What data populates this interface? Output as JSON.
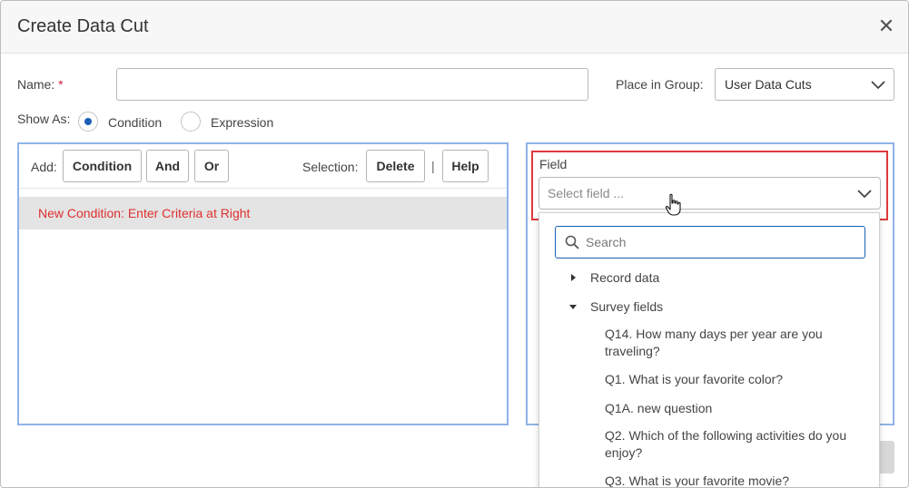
{
  "dialog": {
    "title": "Create Data Cut",
    "close_glyph": "✕"
  },
  "form": {
    "name_label": "Name:",
    "required_mark": "*",
    "name_value": "",
    "group_label": "Place in Group:",
    "group_value": "User Data Cuts",
    "show_as_label": "Show As:",
    "show_as_options": [
      {
        "label": "Condition",
        "selected": true
      },
      {
        "label": "Expression",
        "selected": false
      }
    ]
  },
  "left_panel": {
    "add_label": "Add:",
    "add_buttons": [
      "Condition",
      "And",
      "Or"
    ],
    "selection_label": "Selection:",
    "selection_buttons": [
      "Delete",
      "Help"
    ],
    "separator": "|",
    "condition_row": "New Condition: Enter Criteria at Right"
  },
  "right_panel": {
    "field_label": "Field",
    "field_placeholder": "Select field ...",
    "search_placeholder": "Search",
    "tree": [
      {
        "label": "Record data",
        "expanded": false
      },
      {
        "label": "Survey fields",
        "expanded": true
      }
    ],
    "questions": [
      "Q14. How many days per year are you traveling?",
      "Q1. What is your favorite color?",
      "Q1A. new question",
      "Q2. Which of the following activities do you enjoy?",
      "Q3. What is your favorite movie?"
    ]
  },
  "colors": {
    "accent": "#1a5fb4",
    "panel_border": "#8fb3e8",
    "highlight_border": "#e0393e",
    "condition_text": "#e03030",
    "required": "#d0203c"
  },
  "icons": [
    "close-icon",
    "chevron-down-icon",
    "search-icon",
    "caret-right-icon",
    "caret-down-icon",
    "hand-pointer-icon"
  ]
}
